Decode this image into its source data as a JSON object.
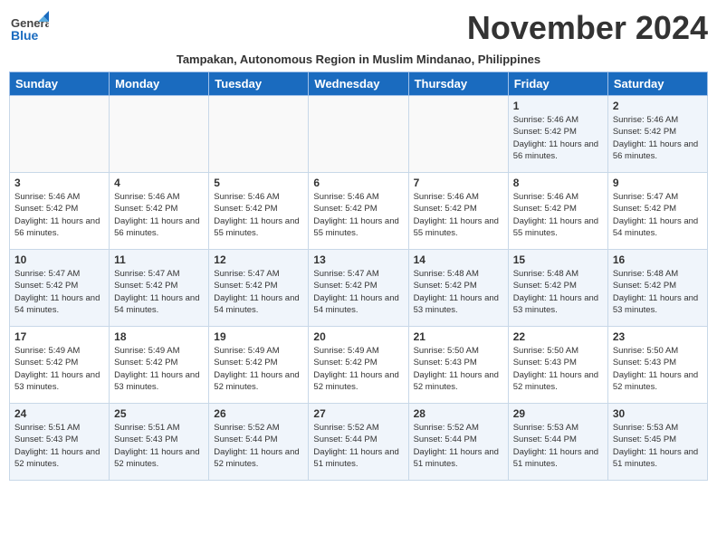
{
  "header": {
    "logo_general": "General",
    "logo_blue": "Blue",
    "month_title": "November 2024",
    "subtitle": "Tampakan, Autonomous Region in Muslim Mindanao, Philippines"
  },
  "days_of_week": [
    "Sunday",
    "Monday",
    "Tuesday",
    "Wednesday",
    "Thursday",
    "Friday",
    "Saturday"
  ],
  "weeks": [
    [
      {
        "day": "",
        "info": ""
      },
      {
        "day": "",
        "info": ""
      },
      {
        "day": "",
        "info": ""
      },
      {
        "day": "",
        "info": ""
      },
      {
        "day": "",
        "info": ""
      },
      {
        "day": "1",
        "info": "Sunrise: 5:46 AM\nSunset: 5:42 PM\nDaylight: 11 hours and 56 minutes."
      },
      {
        "day": "2",
        "info": "Sunrise: 5:46 AM\nSunset: 5:42 PM\nDaylight: 11 hours and 56 minutes."
      }
    ],
    [
      {
        "day": "3",
        "info": "Sunrise: 5:46 AM\nSunset: 5:42 PM\nDaylight: 11 hours and 56 minutes."
      },
      {
        "day": "4",
        "info": "Sunrise: 5:46 AM\nSunset: 5:42 PM\nDaylight: 11 hours and 56 minutes."
      },
      {
        "day": "5",
        "info": "Sunrise: 5:46 AM\nSunset: 5:42 PM\nDaylight: 11 hours and 55 minutes."
      },
      {
        "day": "6",
        "info": "Sunrise: 5:46 AM\nSunset: 5:42 PM\nDaylight: 11 hours and 55 minutes."
      },
      {
        "day": "7",
        "info": "Sunrise: 5:46 AM\nSunset: 5:42 PM\nDaylight: 11 hours and 55 minutes."
      },
      {
        "day": "8",
        "info": "Sunrise: 5:46 AM\nSunset: 5:42 PM\nDaylight: 11 hours and 55 minutes."
      },
      {
        "day": "9",
        "info": "Sunrise: 5:47 AM\nSunset: 5:42 PM\nDaylight: 11 hours and 54 minutes."
      }
    ],
    [
      {
        "day": "10",
        "info": "Sunrise: 5:47 AM\nSunset: 5:42 PM\nDaylight: 11 hours and 54 minutes."
      },
      {
        "day": "11",
        "info": "Sunrise: 5:47 AM\nSunset: 5:42 PM\nDaylight: 11 hours and 54 minutes."
      },
      {
        "day": "12",
        "info": "Sunrise: 5:47 AM\nSunset: 5:42 PM\nDaylight: 11 hours and 54 minutes."
      },
      {
        "day": "13",
        "info": "Sunrise: 5:47 AM\nSunset: 5:42 PM\nDaylight: 11 hours and 54 minutes."
      },
      {
        "day": "14",
        "info": "Sunrise: 5:48 AM\nSunset: 5:42 PM\nDaylight: 11 hours and 53 minutes."
      },
      {
        "day": "15",
        "info": "Sunrise: 5:48 AM\nSunset: 5:42 PM\nDaylight: 11 hours and 53 minutes."
      },
      {
        "day": "16",
        "info": "Sunrise: 5:48 AM\nSunset: 5:42 PM\nDaylight: 11 hours and 53 minutes."
      }
    ],
    [
      {
        "day": "17",
        "info": "Sunrise: 5:49 AM\nSunset: 5:42 PM\nDaylight: 11 hours and 53 minutes."
      },
      {
        "day": "18",
        "info": "Sunrise: 5:49 AM\nSunset: 5:42 PM\nDaylight: 11 hours and 53 minutes."
      },
      {
        "day": "19",
        "info": "Sunrise: 5:49 AM\nSunset: 5:42 PM\nDaylight: 11 hours and 52 minutes."
      },
      {
        "day": "20",
        "info": "Sunrise: 5:49 AM\nSunset: 5:42 PM\nDaylight: 11 hours and 52 minutes."
      },
      {
        "day": "21",
        "info": "Sunrise: 5:50 AM\nSunset: 5:43 PM\nDaylight: 11 hours and 52 minutes."
      },
      {
        "day": "22",
        "info": "Sunrise: 5:50 AM\nSunset: 5:43 PM\nDaylight: 11 hours and 52 minutes."
      },
      {
        "day": "23",
        "info": "Sunrise: 5:50 AM\nSunset: 5:43 PM\nDaylight: 11 hours and 52 minutes."
      }
    ],
    [
      {
        "day": "24",
        "info": "Sunrise: 5:51 AM\nSunset: 5:43 PM\nDaylight: 11 hours and 52 minutes."
      },
      {
        "day": "25",
        "info": "Sunrise: 5:51 AM\nSunset: 5:43 PM\nDaylight: 11 hours and 52 minutes."
      },
      {
        "day": "26",
        "info": "Sunrise: 5:52 AM\nSunset: 5:44 PM\nDaylight: 11 hours and 52 minutes."
      },
      {
        "day": "27",
        "info": "Sunrise: 5:52 AM\nSunset: 5:44 PM\nDaylight: 11 hours and 51 minutes."
      },
      {
        "day": "28",
        "info": "Sunrise: 5:52 AM\nSunset: 5:44 PM\nDaylight: 11 hours and 51 minutes."
      },
      {
        "day": "29",
        "info": "Sunrise: 5:53 AM\nSunset: 5:44 PM\nDaylight: 11 hours and 51 minutes."
      },
      {
        "day": "30",
        "info": "Sunrise: 5:53 AM\nSunset: 5:45 PM\nDaylight: 11 hours and 51 minutes."
      }
    ]
  ]
}
